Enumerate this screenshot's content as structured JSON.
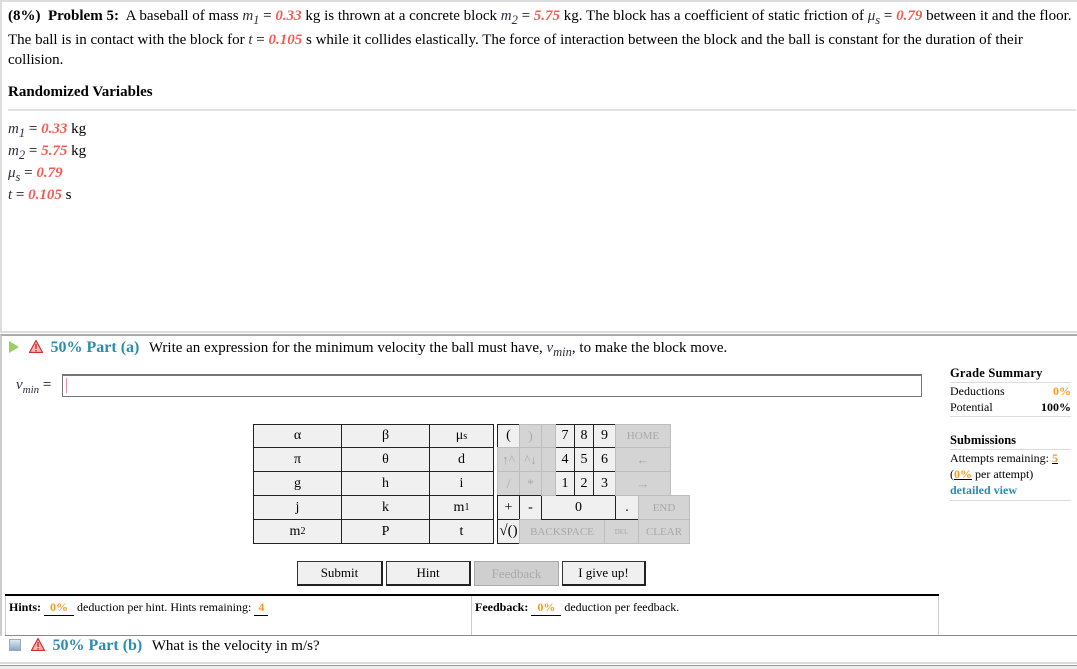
{
  "problem": {
    "weight": "(8%)",
    "label": "Problem 5:",
    "text_parts": [
      "A baseball of mass ",
      " kg is thrown at a concrete block ",
      " kg. The block has a coefficient of static friction of ",
      " between it and the floor. The ball is in contact with the block for ",
      " s while it collides elastically. The force of interaction between the block and the ball is constant for the duration of their collision."
    ],
    "vars": {
      "m1": {
        "symbol": "m",
        "sub": "1",
        "value": "0.33",
        "unit": "kg"
      },
      "m2": {
        "symbol": "m",
        "sub": "2",
        "value": "5.75",
        "unit": "kg"
      },
      "mus": {
        "symbol": "μ",
        "sub": "s",
        "value": "0.79",
        "unit": ""
      },
      "t": {
        "symbol": "t",
        "sub": "",
        "value": "0.105",
        "unit": "s"
      }
    },
    "equals": "="
  },
  "randomized": {
    "title": "Randomized Variables"
  },
  "part_a": {
    "percent_label": "50% Part (a)",
    "question_before": "Write an expression for the minimum velocity the ball must have, ",
    "question_var": "v",
    "question_var_sub": "min",
    "question_after": ", to make the block move.",
    "answer_label": "v",
    "answer_label_sub": "min",
    "answer_equals": "=",
    "answer_value": ""
  },
  "grade_summary": {
    "title": "Grade Summary",
    "deductions_label": "Deductions",
    "deductions_value": "0%",
    "potential_label": "Potential",
    "potential_value": "100%"
  },
  "submissions": {
    "title": "Submissions",
    "attempts_label": "Attempts remaining:",
    "attempts_value": "5",
    "per_attempt_value": "0%",
    "per_attempt_label": "per attempt)",
    "detailed_view": "detailed view"
  },
  "keypad": {
    "variables": [
      [
        "α",
        "β",
        "μs"
      ],
      [
        "π",
        "θ",
        "d"
      ],
      [
        "g",
        "h",
        "i"
      ],
      [
        "j",
        "k",
        "m1"
      ],
      [
        "m2",
        "P",
        "t"
      ]
    ],
    "ops": {
      "lparen": "(",
      "rparen": ")",
      "up": "↑^",
      "down": "^↓",
      "div": "/",
      "mul": "*",
      "plus": "+",
      "minus": "-",
      "sqrt": "√()",
      "backspace": "BACKSPACE",
      "del": "DEL",
      "clear": "CLEAR",
      "home": "HOME",
      "left": "←",
      "right": "→",
      "end": "END",
      "dot": "."
    },
    "digits": [
      "7",
      "8",
      "9",
      "4",
      "5",
      "6",
      "1",
      "2",
      "3",
      "0"
    ]
  },
  "buttons": {
    "submit": "Submit",
    "hint": "Hint",
    "feedback": "Feedback",
    "give_up": "I give up!"
  },
  "hints": {
    "label": "Hints:",
    "deduction": "0%",
    "text": "deduction per hint. Hints remaining:",
    "remaining": "4"
  },
  "feedback": {
    "label": "Feedback:",
    "deduction": "0%",
    "text": "deduction per feedback."
  },
  "part_b": {
    "percent_label": "50% Part (b)",
    "question": "What is the velocity in m/s?"
  },
  "colors": {
    "variable_value": "#f25c54",
    "part_label": "#2b8cb0",
    "percent_orange": "#f59a23"
  }
}
